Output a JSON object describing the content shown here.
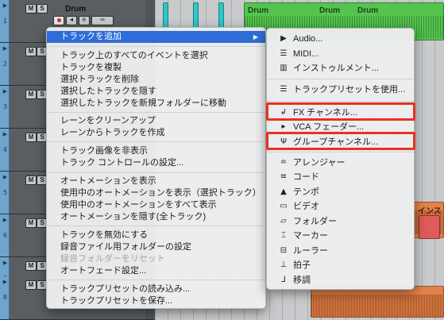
{
  "tracks": [
    {
      "name": "Drum",
      "number": "1",
      "controls": {
        "mute": "M",
        "solo": "S",
        "edit": "e"
      }
    },
    {
      "name": "",
      "number": "2",
      "controls": {
        "mute": "M",
        "solo": "S"
      }
    },
    {
      "name": "",
      "number": "3",
      "controls": {
        "mute": "M",
        "solo": "S"
      }
    },
    {
      "name": "",
      "number": "4",
      "controls": {
        "mute": "M",
        "solo": "S"
      }
    },
    {
      "name": "",
      "number": "5",
      "controls": {
        "mute": "M",
        "solo": "S"
      }
    },
    {
      "name": "",
      "number": "6",
      "controls": {
        "mute": "M",
        "solo": "S"
      }
    },
    {
      "name": "",
      "number": "7",
      "controls": {
        "mute": "M",
        "solo": "S"
      }
    },
    {
      "name": "",
      "number": "8",
      "controls": {
        "mute": "M",
        "solo": "S"
      }
    }
  ],
  "clips": {
    "drum_labels": [
      "Drum",
      "Drum",
      "Drum"
    ],
    "partial_label": "インス"
  },
  "context_menu": {
    "add_track": "トラックを追加",
    "items": [
      "トラック上のすべてのイベントを選択",
      "トラックを複製",
      "選択トラックを削除",
      "選択したトラックを隠す",
      "選択したトラックを新規フォルダーに移動",
      "レーンをクリーンアップ",
      "レーンからトラックを作成",
      "トラック画像を非表示",
      "トラック コントロールの設定...",
      "オートメーションを表示",
      "使用中のオートメーションを表示（選択トラック）",
      "使用中のオートメーションをすべて表示",
      "オートメーションを隠す(全トラック)",
      "トラックを無効にする",
      "録音ファイル用フォルダーの設定",
      "録音フォルダーをリセット",
      "オートフェード設定...",
      "トラックプリセットの読み込み...",
      "トラックプリセットを保存..."
    ]
  },
  "submenu": {
    "items": [
      {
        "label": "Audio...",
        "icon": "audio-icon"
      },
      {
        "label": "MIDI...",
        "icon": "midi-icon"
      },
      {
        "label": "インストゥルメント...",
        "icon": "instrument-icon"
      },
      {
        "label": "トラックプリセットを使用...",
        "icon": "track-preset-icon"
      },
      {
        "label": "FX チャンネル...",
        "icon": "fx-channel-icon"
      },
      {
        "label": "VCA フェーダー...",
        "icon": "vca-fader-icon"
      },
      {
        "label": "グループチャンネル...",
        "icon": "group-channel-icon"
      },
      {
        "label": "アレンジャー",
        "icon": "arranger-icon"
      },
      {
        "label": "コード",
        "icon": "chord-icon"
      },
      {
        "label": "テンポ",
        "icon": "tempo-icon"
      },
      {
        "label": "ビデオ",
        "icon": "video-icon"
      },
      {
        "label": "フォルダー",
        "icon": "folder-icon"
      },
      {
        "label": "マーカー",
        "icon": "marker-icon"
      },
      {
        "label": "ルーラー",
        "icon": "ruler-icon"
      },
      {
        "label": "拍子",
        "icon": "signature-icon"
      },
      {
        "label": "移調",
        "icon": "transpose-icon"
      }
    ],
    "highlighted": [
      "FX チャンネル...",
      "グループチャンネル..."
    ]
  },
  "colors": {
    "highlight_box": "#e8321c",
    "menu_selected": "#2e6cd8",
    "drum_clip": "#55c44f",
    "audio_clip": "#e0824a"
  }
}
